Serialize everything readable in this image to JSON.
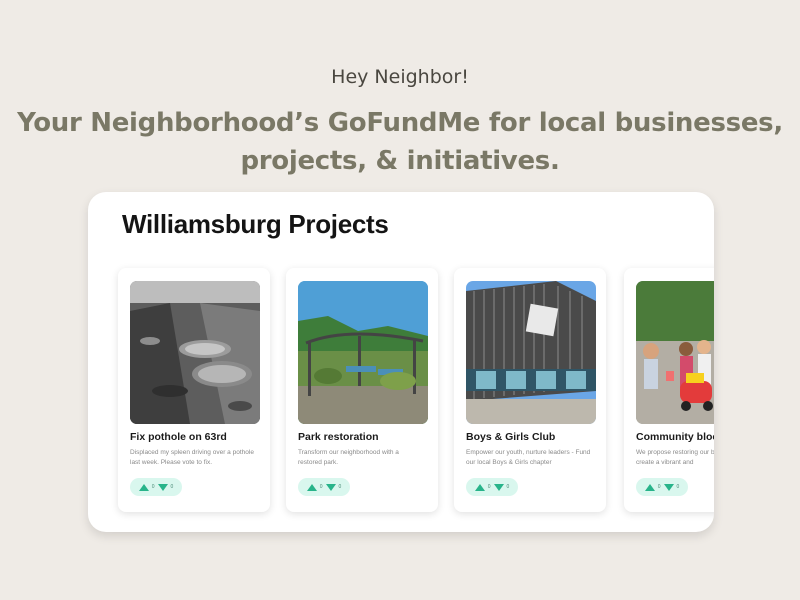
{
  "hero": {
    "greeting": "Hey Neighbor!",
    "tagline": "Your Neighborhood’s GoFundMe for local businesses, projects, & initiatives",
    "tagline_end": "."
  },
  "panel": {
    "title": "Williamsburg Projects"
  },
  "projects": [
    {
      "title": "Fix pothole on 63rd",
      "description": "Displaced my spleen driving over a pothole last week. Please vote to fix.",
      "up_votes": "0",
      "down_votes": "0",
      "up_icon": "upvote-icon",
      "down_icon": "downvote-icon"
    },
    {
      "title": "Park restoration",
      "description": "Transform our neighborhood with a restored park.",
      "up_votes": "0",
      "down_votes": "0",
      "up_icon": "upvote-icon",
      "down_icon": "downvote-icon"
    },
    {
      "title": "Boys & Girls Club",
      "description": "Empower our youth, nurture leaders - Fund our local Boys & Girls chapter",
      "up_votes": "0",
      "down_votes": "0",
      "up_icon": "upvote-icon",
      "down_icon": "downvote-icon"
    },
    {
      "title": "Community block party",
      "description": "We propose restoring our block party. To create a vibrant and",
      "up_votes": "0",
      "down_votes": "0",
      "up_icon": "upvote-icon",
      "down_icon": "downvote-icon"
    }
  ],
  "colors": {
    "background": "#efebe6",
    "tagline": "#7a7866",
    "vote_pill": "#d9f7ee",
    "vote_arrow": "#28b48a"
  }
}
